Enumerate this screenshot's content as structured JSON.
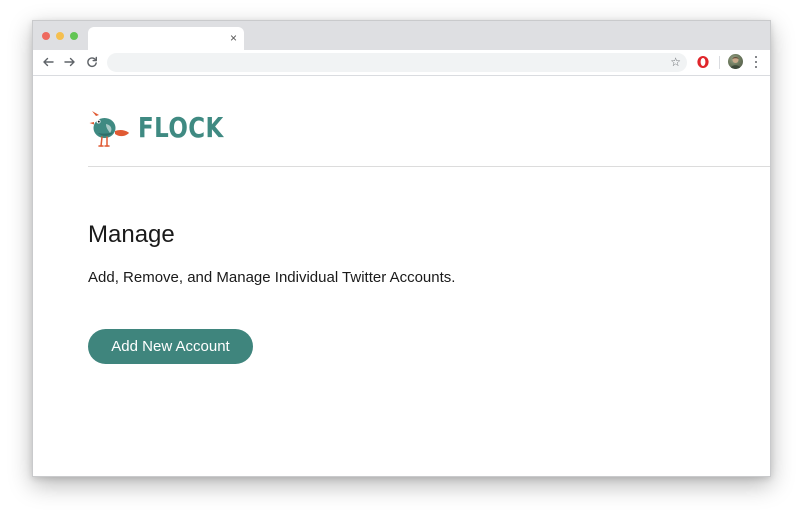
{
  "browser": {
    "tab_close": "×",
    "star": "☆",
    "avatar_alt": "profile"
  },
  "brand": {
    "name": "FLOCK",
    "color": "#3f8a82"
  },
  "page": {
    "title": "Manage",
    "description": "Add, Remove, and Manage Individual Twitter Accounts.",
    "add_button_label": "Add New Account"
  },
  "colors": {
    "button_bg": "#3f857d",
    "text": "#1a1a1a"
  }
}
